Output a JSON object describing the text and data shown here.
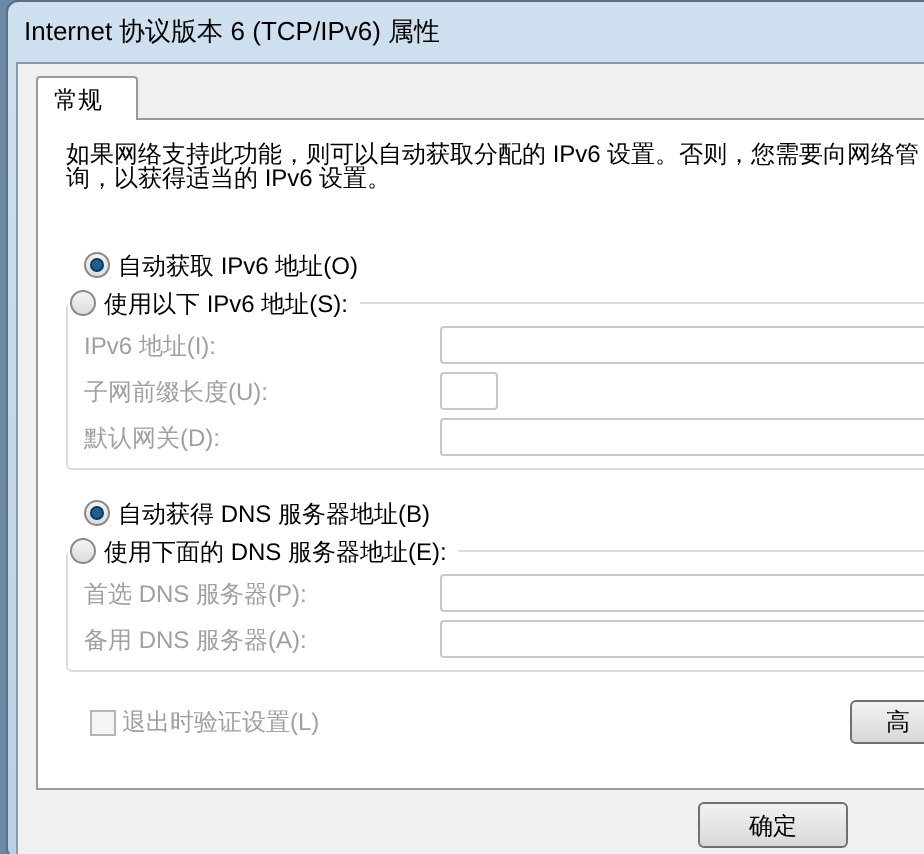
{
  "window": {
    "title": "Internet 协议版本 6 (TCP/IPv6) 属性"
  },
  "tabs": [
    {
      "label": "常规",
      "selected": true
    }
  ],
  "description": [
    "如果网络支持此功能，则可以自动获取分配的 IPv6 设置。否则，您需要向网络管",
    "询，以获得适当的 IPv6 设置。"
  ],
  "sections": [
    {
      "options": [
        {
          "label": "自动获取 IPv6 地址(O)",
          "selected": true
        },
        {
          "label": "使用以下 IPv6 地址(S):",
          "selected": false
        }
      ],
      "fields": [
        {
          "label": "IPv6 地址(I):",
          "kind": "wide",
          "disabled": true
        },
        {
          "label": "子网前缀长度(U):",
          "kind": "short",
          "disabled": true
        },
        {
          "label": "默认网关(D):",
          "kind": "wide",
          "disabled": true
        }
      ]
    },
    {
      "options": [
        {
          "label": "自动获得 DNS 服务器地址(B)",
          "selected": true
        },
        {
          "label": "使用下面的 DNS 服务器地址(E):",
          "selected": false
        }
      ],
      "fields": [
        {
          "label": "首选 DNS 服务器(P):",
          "kind": "wide",
          "disabled": true
        },
        {
          "label": "备用 DNS 服务器(A):",
          "kind": "wide",
          "disabled": true
        }
      ]
    }
  ],
  "validate_on_exit": {
    "label": "退出时验证设置(L)",
    "checked": false,
    "disabled": true
  },
  "advanced_button": "高",
  "ok_button": "确定"
}
